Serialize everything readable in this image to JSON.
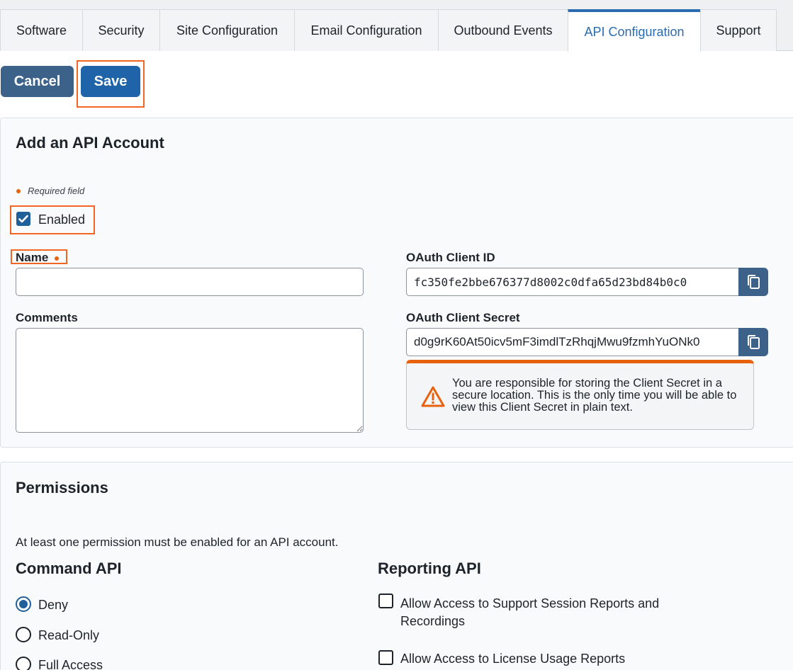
{
  "tabs": [
    {
      "label": "Software"
    },
    {
      "label": "Security"
    },
    {
      "label": "Site Configuration"
    },
    {
      "label": "Email Configuration"
    },
    {
      "label": "Outbound Events"
    },
    {
      "label": "API Configuration"
    },
    {
      "label": "Support"
    }
  ],
  "active_tab": "API Configuration",
  "actions": {
    "cancel_label": "Cancel",
    "save_label": "Save"
  },
  "account_section": {
    "title": "Add an API Account",
    "required_note": "Required field",
    "enabled_label": "Enabled",
    "enabled_checked": true,
    "name_label": "Name",
    "name_value": "",
    "comments_label": "Comments",
    "comments_value": "",
    "client_id_label": "OAuth Client ID",
    "client_id_value": "fc350fe2bbe676377d8002c0dfa65d23bd84b0c0",
    "client_secret_label": "OAuth Client Secret",
    "client_secret_value": "d0g9rK60At50icv5mF3imdlTzRhqjMwu9fzmhYuONk0",
    "warning_text": "You are responsible for storing the Client Secret in a secure location. This is the only time you will be able to view this Client Secret in plain text."
  },
  "permissions": {
    "title": "Permissions",
    "note": "At least one permission must be enabled for an API account.",
    "command_api": {
      "title": "Command API",
      "options": [
        "Deny",
        "Read-Only",
        "Full Access"
      ],
      "selected": "Deny"
    },
    "reporting_api": {
      "title": "Reporting API",
      "options": [
        {
          "label": "Allow Access to Support Session Reports and Recordings",
          "checked": false
        },
        {
          "label": "Allow Access to License Usage Reports",
          "checked": false
        }
      ]
    }
  },
  "colors": {
    "primary": "#1f63a8",
    "secondary": "#3d6289",
    "highlight": "#f26522",
    "required": "#e8620e"
  }
}
